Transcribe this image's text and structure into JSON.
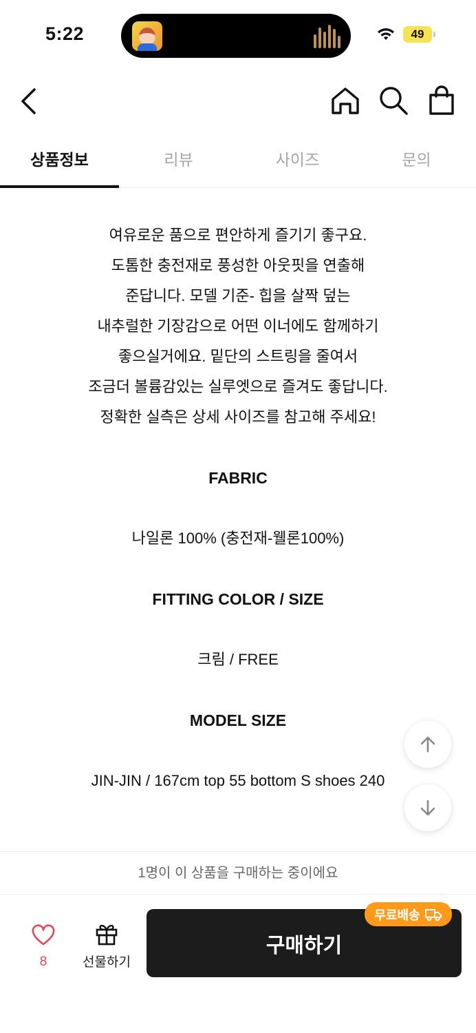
{
  "status_bar": {
    "time": "5:22",
    "battery": "49"
  },
  "tabs": [
    {
      "label": "상품정보",
      "active": true
    },
    {
      "label": "리뷰",
      "active": false
    },
    {
      "label": "사이즈",
      "active": false
    },
    {
      "label": "문의",
      "active": false
    }
  ],
  "description": [
    "여유로운 품으로 편안하게 즐기기 좋구요.",
    "도톰한 충전재로 풍성한 아웃핏을 연출해",
    "준답니다. 모델 기준- 힙을 살짝 덮는",
    "내추럴한 기장감으로 어떤 이너에도 함께하기",
    "좋으실거에요. 밑단의 스트링을 줄여서",
    "조금더 볼륨감있는 실루엣으로 즐겨도 좋답니다.",
    "정확한 실측은 상세 사이즈를 참고해 주세요!"
  ],
  "fabric": {
    "title": "FABRIC",
    "value": "나일론 100% (충전재-웰론100%)"
  },
  "fitting": {
    "title": "FITTING COLOR / SIZE",
    "value": "크림 / FREE"
  },
  "model": {
    "title": "MODEL SIZE",
    "value": "JIN-JIN / 167cm top 55 bottom S shoes 240"
  },
  "purchase_notice": "1명이 이 상품을 구매하는 중이에요",
  "bottom_bar": {
    "like_count": "8",
    "gift_label": "선물하기",
    "buy_label": "구매하기",
    "shipping_badge": "무료배송"
  },
  "colors": {
    "accent_orange": "#ff9a1a",
    "like_red": "#e0465a",
    "buy_button": "#1c1c1c"
  }
}
